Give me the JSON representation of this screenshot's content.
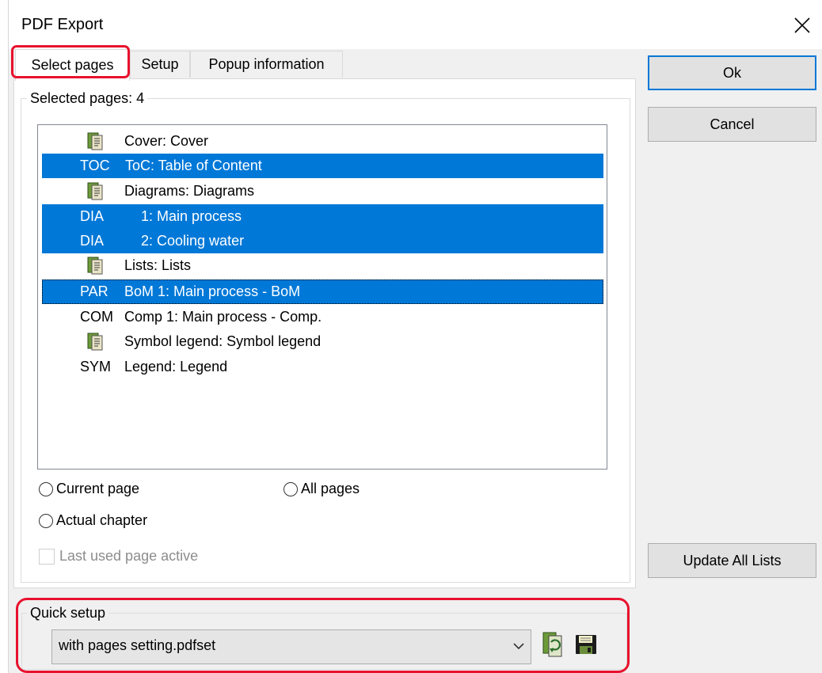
{
  "window": {
    "title": "PDF Export",
    "close_glyph": "✕"
  },
  "tabs": [
    {
      "label": "Select pages",
      "active": true
    },
    {
      "label": "Setup",
      "active": false
    },
    {
      "label": "Popup information",
      "active": false
    }
  ],
  "select_pages": {
    "group_label": "Selected pages: 4",
    "pages": [
      {
        "code": "",
        "icon": "book-icon",
        "text": "Cover: Cover",
        "selected": false
      },
      {
        "code": "TOC",
        "icon": "",
        "text": "ToC: Table of Content",
        "selected": true
      },
      {
        "code": "",
        "icon": "book-icon",
        "text": "Diagrams: Diagrams",
        "selected": false
      },
      {
        "code": "DIA",
        "icon": "",
        "text": "1: Main process",
        "selected": true
      },
      {
        "code": "DIA",
        "icon": "",
        "text": "2: Cooling water",
        "selected": true
      },
      {
        "code": "",
        "icon": "book-icon",
        "text": "Lists: Lists",
        "selected": false
      },
      {
        "code": "PAR",
        "icon": "",
        "text": "BoM 1: Main process - BoM",
        "selected": true,
        "focused": true
      },
      {
        "code": "COM",
        "icon": "",
        "text": "Comp 1: Main process - Comp.",
        "selected": false
      },
      {
        "code": "",
        "icon": "book-icon",
        "text": "Symbol legend: Symbol legend",
        "selected": false
      },
      {
        "code": "SYM",
        "icon": "",
        "text": "Legend: Legend",
        "selected": false
      }
    ],
    "radio_current": "Current page",
    "radio_all": "All pages",
    "radio_chapter": "Actual chapter",
    "checkbox_last_used": "Last used page active"
  },
  "buttons": {
    "ok": "Ok",
    "cancel": "Cancel",
    "update_all_lists": "Update All Lists"
  },
  "quick_setup": {
    "group_label": "Quick setup",
    "selected_value": "with pages setting.pdfset",
    "load_icon": "load-settings-icon",
    "save_icon": "save-icon"
  },
  "colors": {
    "selection": "#0078d7",
    "highlight_annotation": "#e8112d",
    "dialog_bg": "#f0f0f0"
  }
}
